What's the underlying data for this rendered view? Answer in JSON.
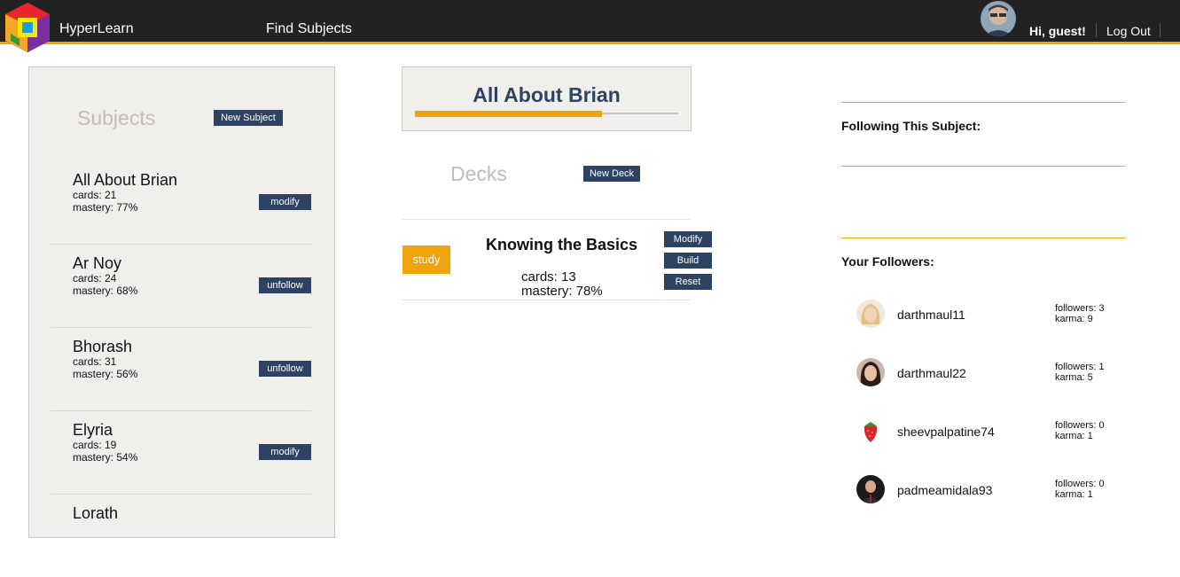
{
  "header": {
    "brand": "HyperLearn",
    "find_subjects": "Find Subjects",
    "greeting": "Hi, guest!",
    "logout": "Log Out"
  },
  "sidebar": {
    "title": "Subjects",
    "new_subject": "New Subject",
    "subjects": [
      {
        "name": "All About Brian",
        "cards": "cards: 21",
        "mastery": "mastery: 77%",
        "action": "modify"
      },
      {
        "name": "Ar Noy",
        "cards": "cards: 24",
        "mastery": "mastery: 68%",
        "action": "unfollow"
      },
      {
        "name": "Bhorash",
        "cards": "cards: 31",
        "mastery": "mastery: 56%",
        "action": "unfollow"
      },
      {
        "name": "Elyria",
        "cards": "cards: 19",
        "mastery": "mastery: 54%",
        "action": "modify"
      },
      {
        "name": "Lorath",
        "cards": "",
        "mastery": "",
        "action": ""
      }
    ]
  },
  "main": {
    "subject_title": "All About Brian",
    "subject_progress": 0.71,
    "decks_title": "Decks",
    "new_deck": "New Deck",
    "deck": {
      "study": "study",
      "name": "Knowing the Basics",
      "cards": "cards: 13",
      "mastery": "mastery: 78%",
      "modify": "Modify",
      "build": "Build",
      "reset": "Reset"
    }
  },
  "right": {
    "following_title": "Following This Subject:",
    "followers_title": "Your Followers:",
    "followers": [
      {
        "name": "darthmaul11",
        "followers": "followers: 3",
        "karma": "karma: 9",
        "avatar": "blonde-woman"
      },
      {
        "name": "darthmaul22",
        "followers": "followers: 1",
        "karma": "karma: 5",
        "avatar": "dark-hair-woman"
      },
      {
        "name": "sheevpalpatine74",
        "followers": "followers: 0",
        "karma": "karma: 1",
        "avatar": "strawberry"
      },
      {
        "name": "padmeamidala93",
        "followers": "followers: 0",
        "karma": "karma: 1",
        "avatar": "man-in-suit"
      }
    ]
  },
  "colors": {
    "accent": "#f0a30a",
    "navy": "#2e4363",
    "header": "#222222",
    "panel": "#f1efeb"
  }
}
